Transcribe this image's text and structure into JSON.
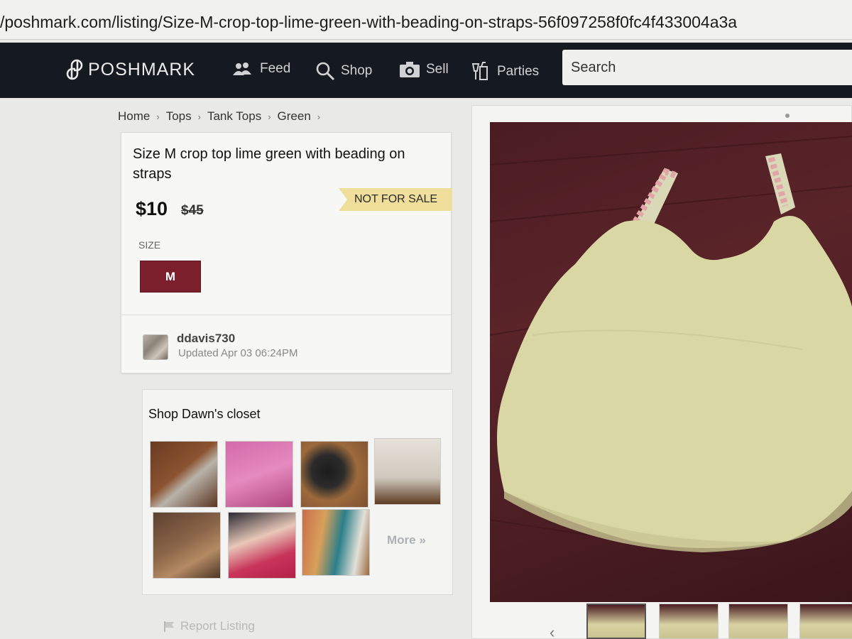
{
  "browser": {
    "url": "/poshmark.com/listing/Size-M-crop-top-lime-green-with-beading-on-straps-56f097258f0fc4f433004a3a"
  },
  "header": {
    "logo_text": "POSHMARK",
    "nav": {
      "feed": "Feed",
      "shop": "Shop",
      "sell": "Sell",
      "parties": "Parties"
    },
    "search_placeholder": "Search"
  },
  "breadcrumb": {
    "items": [
      "Home",
      "Tops",
      "Tank Tops",
      "Green"
    ],
    "separator": "›"
  },
  "listing": {
    "title": "Size M crop top lime green with beading on straps",
    "price": "$10",
    "original_price": "$45",
    "status_badge": "NOT FOR SALE",
    "size_label": "SIZE",
    "size_value": "M",
    "seller": {
      "username": "ddavis730",
      "updated": "Updated Apr 03 06:24PM"
    }
  },
  "closet": {
    "title": "Shop Dawn's closet",
    "more_link": "More »",
    "item_count": 7
  },
  "footer": {
    "report_link": "Report Listing"
  },
  "colors": {
    "header_bg": "#141a1f",
    "size_button": "#7a1f2b",
    "badge": "#efdf9a",
    "top_fabric": "#d9d8a4"
  }
}
